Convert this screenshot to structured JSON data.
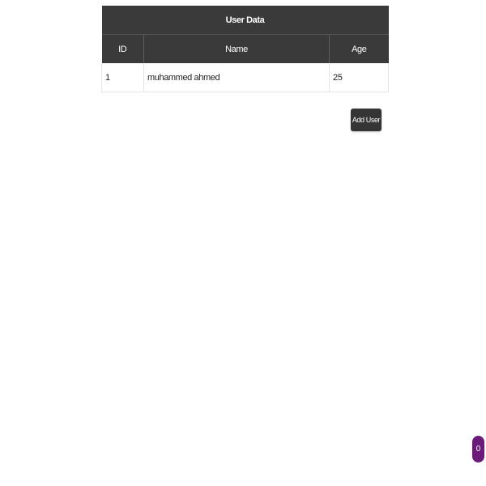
{
  "table": {
    "caption": "User Data",
    "columns": [
      "ID",
      "Name",
      "Age"
    ],
    "rows": [
      {
        "id": "1",
        "name": "muhammed ahmed",
        "age": "25"
      }
    ]
  },
  "actions": {
    "add_user_label": "Add User"
  },
  "badge": {
    "count": "0",
    "color": "#6a1b7a"
  },
  "colors": {
    "header_bg": "#3a3a3a",
    "button_bg": "#353535"
  }
}
